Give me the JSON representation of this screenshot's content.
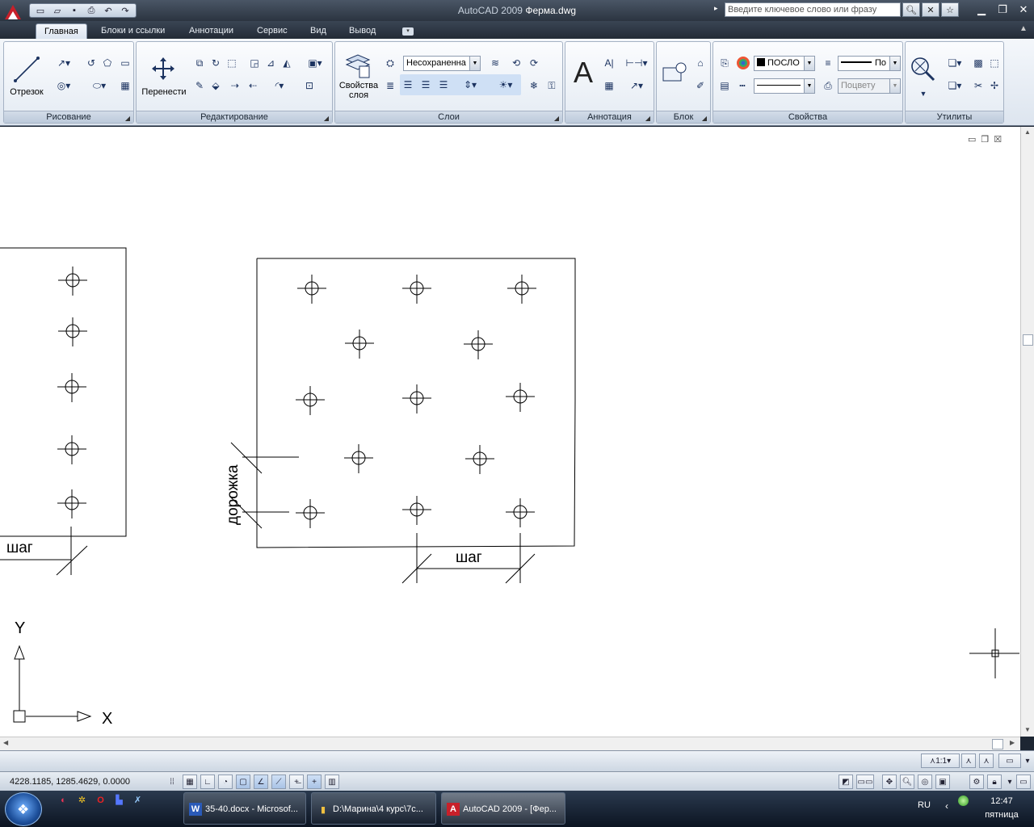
{
  "titlebar": {
    "app_title": "AutoCAD 2009",
    "file_name": "Ферма.dwg",
    "search_placeholder": "Введите ключевое слово или фразу"
  },
  "ribbon_tabs": [
    "Главная",
    "Блоки и ссылки",
    "Аннотации",
    "Сервис",
    "Вид",
    "Вывод"
  ],
  "panels": {
    "draw": {
      "title": "Рисование",
      "line_label": "Отрезок"
    },
    "modify": {
      "title": "Редактирование",
      "move_label": "Перенести"
    },
    "layers": {
      "title": "Слои",
      "layer_props_label": "Свойства слоя",
      "layer_state": "Несохраненна"
    },
    "annotation": {
      "title": "Аннотация"
    },
    "block": {
      "title": "Блок"
    },
    "properties": {
      "title": "Свойства",
      "color_value": "ПОСЛО",
      "lineweight_value": "По",
      "plotstyle_value": "Поцвету"
    },
    "utilities": {
      "title": "Утилиты"
    }
  },
  "drawing": {
    "label_step_left": "шаг",
    "label_step_right": "шаг",
    "label_path": "дорожка",
    "axis_y": "Y",
    "axis_x": "X"
  },
  "status": {
    "coordinates": "4228.1185, 1285.4629, 0.0000",
    "annotation_scale": "1:1"
  },
  "taskbar": {
    "tasks": [
      {
        "icon": "W",
        "label": "35-40.docx - Microsof..."
      },
      {
        "icon": "▮",
        "label": "D:\\Марина\\4 курс\\7с..."
      },
      {
        "icon": "A",
        "label": "AutoCAD 2009 - [Фер..."
      }
    ],
    "language": "RU",
    "time": "12:47",
    "day": "пятница"
  }
}
